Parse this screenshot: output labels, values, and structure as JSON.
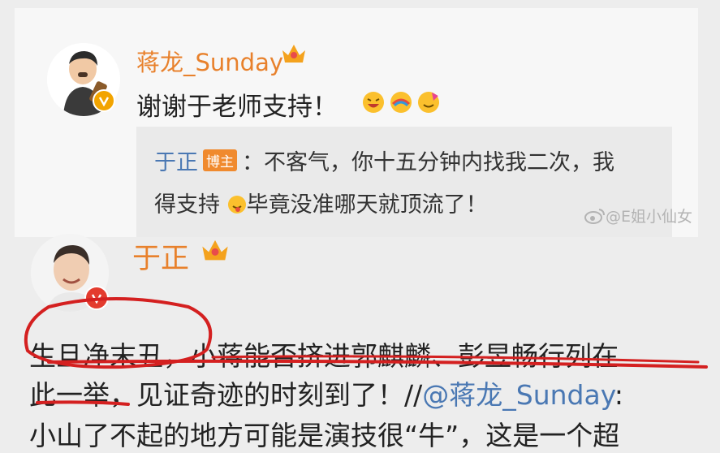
{
  "reply_card": {
    "author": "蒋龙_Sunday",
    "message": "谢谢于老师支持！",
    "emoji_icons": [
      "laughing-face-icon",
      "rainbow-face-icon",
      "party-face-icon"
    ],
    "quote": {
      "author": "于正",
      "badge": "博主",
      "line1": "：不客气，你十五分钟内找我二次，我",
      "line2_a": "得支持",
      "line2_b": "毕竟没准哪天就顶流了！"
    }
  },
  "watermark": "@E姐小仙女",
  "post": {
    "author": "于正",
    "line1": "生旦净末丑，小蒋能否挤进郭麒麟、彭昱畅行列在",
    "line2_a": "此一举，见证奇迹的时刻到了！//",
    "line2_mention": "@蒋龙_Sunday",
    "line2_b": ":",
    "line3": "小山了不起的地方可能是演技很“牛”，这是一个超"
  },
  "colors": {
    "username": "#e8812c",
    "link": "#4a78b3",
    "annotation": "#d42020"
  }
}
